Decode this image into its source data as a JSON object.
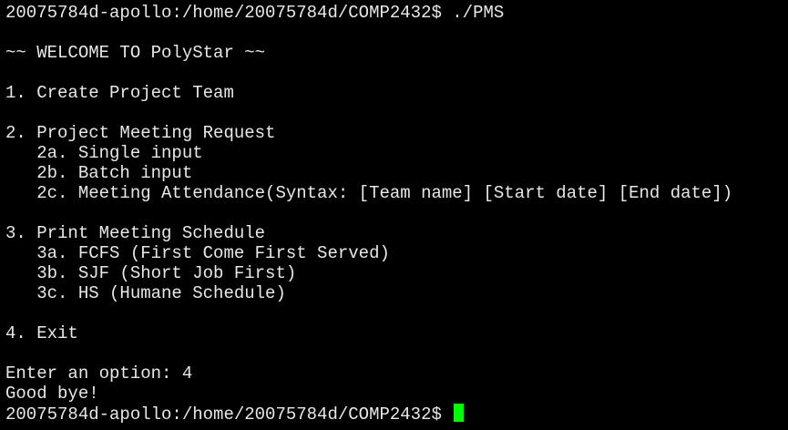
{
  "terminal": {
    "lines": [
      "20075784d-apollo:/home/20075784d/COMP2432$ ./PMS",
      "",
      "~~ WELCOME TO PolyStar ~~",
      "",
      "1. Create Project Team",
      "",
      "2. Project Meeting Request",
      "   2a. Single input",
      "   2b. Batch input",
      "   2c. Meeting Attendance(Syntax: [Team name] [Start date] [End date])",
      "",
      "3. Print Meeting Schedule",
      "   3a. FCFS (First Come First Served)",
      "   3b. SJF (Short Job First)",
      "   3c. HS (Humane Schedule)",
      "",
      "4. Exit",
      "",
      "Enter an option: 4",
      "Good bye!"
    ],
    "prompt": "20075784d-apollo:/home/20075784d/COMP2432$ ",
    "cursor_color": "#00ff00",
    "background_color": "#000000",
    "text_color": "#e8e8e8"
  }
}
